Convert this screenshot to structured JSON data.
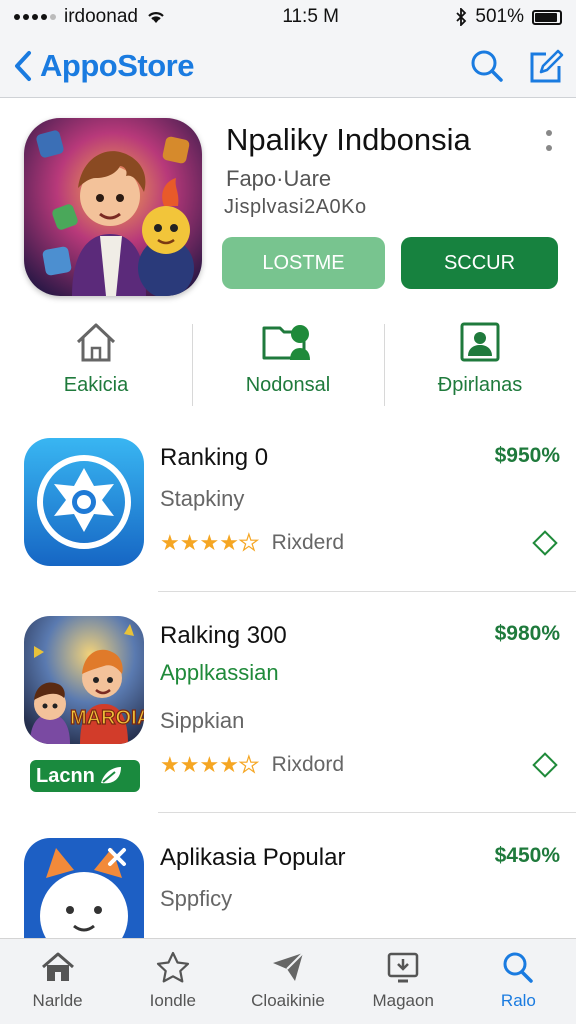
{
  "status_bar": {
    "carrier": "irdoonad",
    "time": "11:5 M",
    "battery": "501%"
  },
  "nav": {
    "title": "AppoStore"
  },
  "hero": {
    "title": "Npaliky Indbonsia",
    "subtitle1": "Fapo·Uare",
    "subtitle2": "Jisplvasi2A0Ko",
    "button_light": "LOSTME",
    "button_dark": "SCCUR"
  },
  "categories": [
    {
      "label": "Eakicia",
      "icon": "home-icon"
    },
    {
      "label": "Nodonsal",
      "icon": "folder-person-icon"
    },
    {
      "label": "Ðpirlanas",
      "icon": "contact-card-icon"
    }
  ],
  "apps": [
    {
      "title": "Ranking 0",
      "price": "$950%",
      "subtitle": "Stapkiny",
      "rating_label": "Rixderd",
      "stars": 4.5
    },
    {
      "title": "Ralking 300",
      "price": "$980%",
      "green_line": "Applkassian",
      "subtitle": "Sippkian",
      "rating_label": "Rixdord",
      "badge": "Lacnn",
      "icon_text": "MAROIA",
      "stars": 4.5
    },
    {
      "title": "Aplikasia Popular",
      "price": "$450%",
      "subtitle": "Sppficy"
    }
  ],
  "tabs": [
    {
      "label": "Narlde",
      "icon": "home-icon"
    },
    {
      "label": "Iondle",
      "icon": "star-icon"
    },
    {
      "label": "Cloaikinie",
      "icon": "paper-plane-icon"
    },
    {
      "label": "Magaon",
      "icon": "download-icon"
    },
    {
      "label": "Ralo",
      "icon": "search-icon"
    }
  ],
  "colors": {
    "accent_blue": "#1a7be0",
    "brand_green": "#17823f",
    "light_green": "#78c48f",
    "star": "#f5a623"
  }
}
